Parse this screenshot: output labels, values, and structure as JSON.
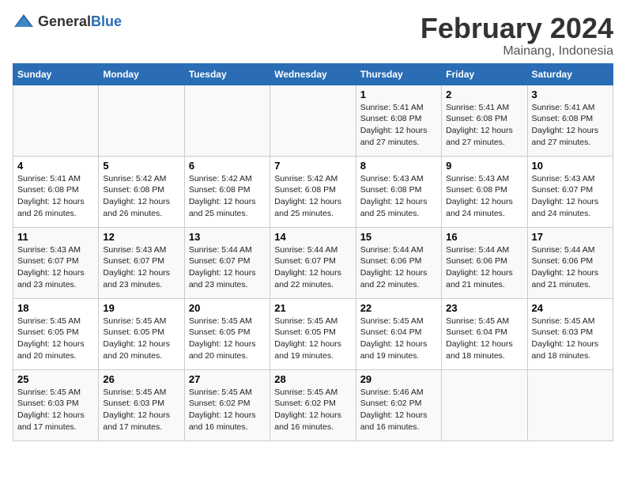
{
  "logo": {
    "text_general": "General",
    "text_blue": "Blue"
  },
  "title": "February 2024",
  "subtitle": "Mainang, Indonesia",
  "days_of_week": [
    "Sunday",
    "Monday",
    "Tuesday",
    "Wednesday",
    "Thursday",
    "Friday",
    "Saturday"
  ],
  "weeks": [
    [
      {
        "day": "",
        "info": ""
      },
      {
        "day": "",
        "info": ""
      },
      {
        "day": "",
        "info": ""
      },
      {
        "day": "",
        "info": ""
      },
      {
        "day": "1",
        "info": "Sunrise: 5:41 AM\nSunset: 6:08 PM\nDaylight: 12 hours and 27 minutes."
      },
      {
        "day": "2",
        "info": "Sunrise: 5:41 AM\nSunset: 6:08 PM\nDaylight: 12 hours and 27 minutes."
      },
      {
        "day": "3",
        "info": "Sunrise: 5:41 AM\nSunset: 6:08 PM\nDaylight: 12 hours and 27 minutes."
      }
    ],
    [
      {
        "day": "4",
        "info": "Sunrise: 5:41 AM\nSunset: 6:08 PM\nDaylight: 12 hours and 26 minutes."
      },
      {
        "day": "5",
        "info": "Sunrise: 5:42 AM\nSunset: 6:08 PM\nDaylight: 12 hours and 26 minutes."
      },
      {
        "day": "6",
        "info": "Sunrise: 5:42 AM\nSunset: 6:08 PM\nDaylight: 12 hours and 25 minutes."
      },
      {
        "day": "7",
        "info": "Sunrise: 5:42 AM\nSunset: 6:08 PM\nDaylight: 12 hours and 25 minutes."
      },
      {
        "day": "8",
        "info": "Sunrise: 5:43 AM\nSunset: 6:08 PM\nDaylight: 12 hours and 25 minutes."
      },
      {
        "day": "9",
        "info": "Sunrise: 5:43 AM\nSunset: 6:08 PM\nDaylight: 12 hours and 24 minutes."
      },
      {
        "day": "10",
        "info": "Sunrise: 5:43 AM\nSunset: 6:07 PM\nDaylight: 12 hours and 24 minutes."
      }
    ],
    [
      {
        "day": "11",
        "info": "Sunrise: 5:43 AM\nSunset: 6:07 PM\nDaylight: 12 hours and 23 minutes."
      },
      {
        "day": "12",
        "info": "Sunrise: 5:43 AM\nSunset: 6:07 PM\nDaylight: 12 hours and 23 minutes."
      },
      {
        "day": "13",
        "info": "Sunrise: 5:44 AM\nSunset: 6:07 PM\nDaylight: 12 hours and 23 minutes."
      },
      {
        "day": "14",
        "info": "Sunrise: 5:44 AM\nSunset: 6:07 PM\nDaylight: 12 hours and 22 minutes."
      },
      {
        "day": "15",
        "info": "Sunrise: 5:44 AM\nSunset: 6:06 PM\nDaylight: 12 hours and 22 minutes."
      },
      {
        "day": "16",
        "info": "Sunrise: 5:44 AM\nSunset: 6:06 PM\nDaylight: 12 hours and 21 minutes."
      },
      {
        "day": "17",
        "info": "Sunrise: 5:44 AM\nSunset: 6:06 PM\nDaylight: 12 hours and 21 minutes."
      }
    ],
    [
      {
        "day": "18",
        "info": "Sunrise: 5:45 AM\nSunset: 6:05 PM\nDaylight: 12 hours and 20 minutes."
      },
      {
        "day": "19",
        "info": "Sunrise: 5:45 AM\nSunset: 6:05 PM\nDaylight: 12 hours and 20 minutes."
      },
      {
        "day": "20",
        "info": "Sunrise: 5:45 AM\nSunset: 6:05 PM\nDaylight: 12 hours and 20 minutes."
      },
      {
        "day": "21",
        "info": "Sunrise: 5:45 AM\nSunset: 6:05 PM\nDaylight: 12 hours and 19 minutes."
      },
      {
        "day": "22",
        "info": "Sunrise: 5:45 AM\nSunset: 6:04 PM\nDaylight: 12 hours and 19 minutes."
      },
      {
        "day": "23",
        "info": "Sunrise: 5:45 AM\nSunset: 6:04 PM\nDaylight: 12 hours and 18 minutes."
      },
      {
        "day": "24",
        "info": "Sunrise: 5:45 AM\nSunset: 6:03 PM\nDaylight: 12 hours and 18 minutes."
      }
    ],
    [
      {
        "day": "25",
        "info": "Sunrise: 5:45 AM\nSunset: 6:03 PM\nDaylight: 12 hours and 17 minutes."
      },
      {
        "day": "26",
        "info": "Sunrise: 5:45 AM\nSunset: 6:03 PM\nDaylight: 12 hours and 17 minutes."
      },
      {
        "day": "27",
        "info": "Sunrise: 5:45 AM\nSunset: 6:02 PM\nDaylight: 12 hours and 16 minutes."
      },
      {
        "day": "28",
        "info": "Sunrise: 5:45 AM\nSunset: 6:02 PM\nDaylight: 12 hours and 16 minutes."
      },
      {
        "day": "29",
        "info": "Sunrise: 5:46 AM\nSunset: 6:02 PM\nDaylight: 12 hours and 16 minutes."
      },
      {
        "day": "",
        "info": ""
      },
      {
        "day": "",
        "info": ""
      }
    ]
  ]
}
